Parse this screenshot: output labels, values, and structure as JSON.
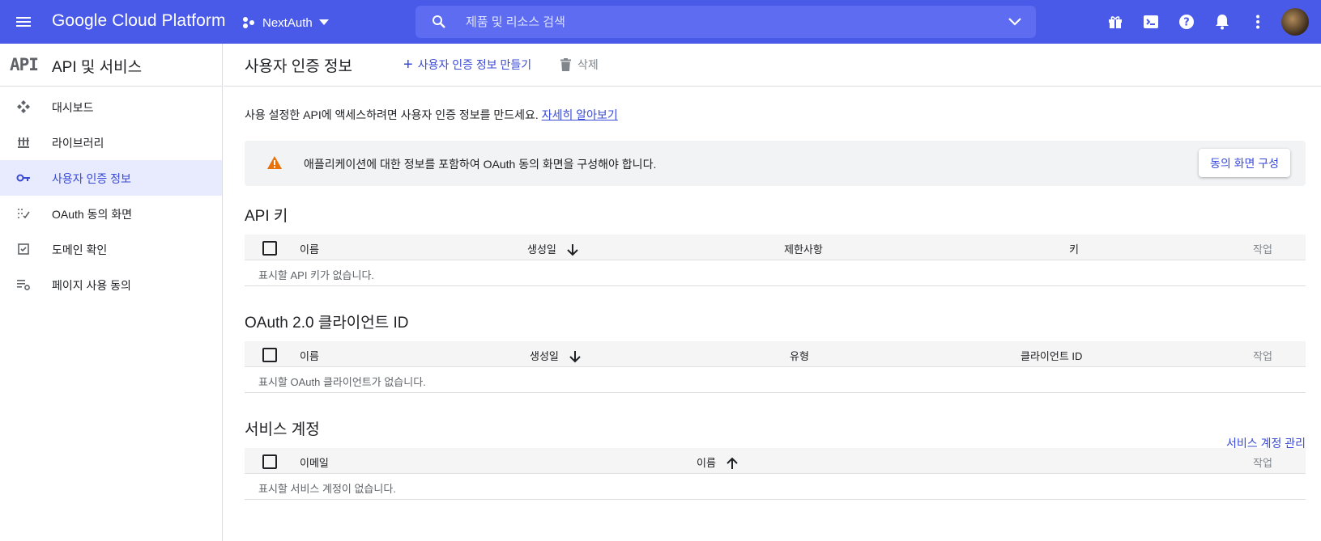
{
  "topbar": {
    "brand": "Google Cloud Platform",
    "project": "NextAuth",
    "search_placeholder": "제품 및 리소스 검색"
  },
  "sidebar": {
    "logo_text": "API",
    "title": "API 및 서비스",
    "items": [
      {
        "label": "대시보드",
        "icon": "dashboard-icon",
        "active": false
      },
      {
        "label": "라이브러리",
        "icon": "library-icon",
        "active": false
      },
      {
        "label": "사용자 인증 정보",
        "icon": "key-icon",
        "active": true
      },
      {
        "label": "OAuth 동의 화면",
        "icon": "consent-icon",
        "active": false
      },
      {
        "label": "도메인 확인",
        "icon": "checkbox-icon",
        "active": false
      },
      {
        "label": "페이지 사용 동의",
        "icon": "settings-list-icon",
        "active": false
      }
    ]
  },
  "main": {
    "title": "사용자 인증 정보",
    "create_label": "사용자 인증 정보 만들기",
    "delete_label": "삭제",
    "intro_text": "사용 설정한 API에 액세스하려면 사용자 인증 정보를 만드세요. ",
    "intro_link": "자세히 알아보기",
    "warning_text": "애플리케이션에 대한 정보를 포함하여 OAuth 동의 화면을 구성해야 합니다.",
    "warning_button": "동의 화면 구성",
    "api_keys": {
      "title": "API 키",
      "columns": [
        "이름",
        "생성일",
        "제한사항",
        "키",
        "작업"
      ],
      "empty": "표시할 API 키가 없습니다."
    },
    "oauth": {
      "title": "OAuth 2.0 클라이언트 ID",
      "columns": [
        "이름",
        "생성일",
        "유형",
        "클라이언트 ID",
        "작업"
      ],
      "empty": "표시할 OAuth 클라이언트가 없습니다."
    },
    "service_accounts": {
      "title": "서비스 계정",
      "manage_link": "서비스 계정 관리",
      "columns": [
        "이메일",
        "이름",
        "작업"
      ],
      "empty": "표시할 서비스 계정이 없습니다."
    }
  },
  "colors": {
    "topbar": "#4a5ae8",
    "accent": "#3949d8",
    "warning": "#e8710a"
  }
}
